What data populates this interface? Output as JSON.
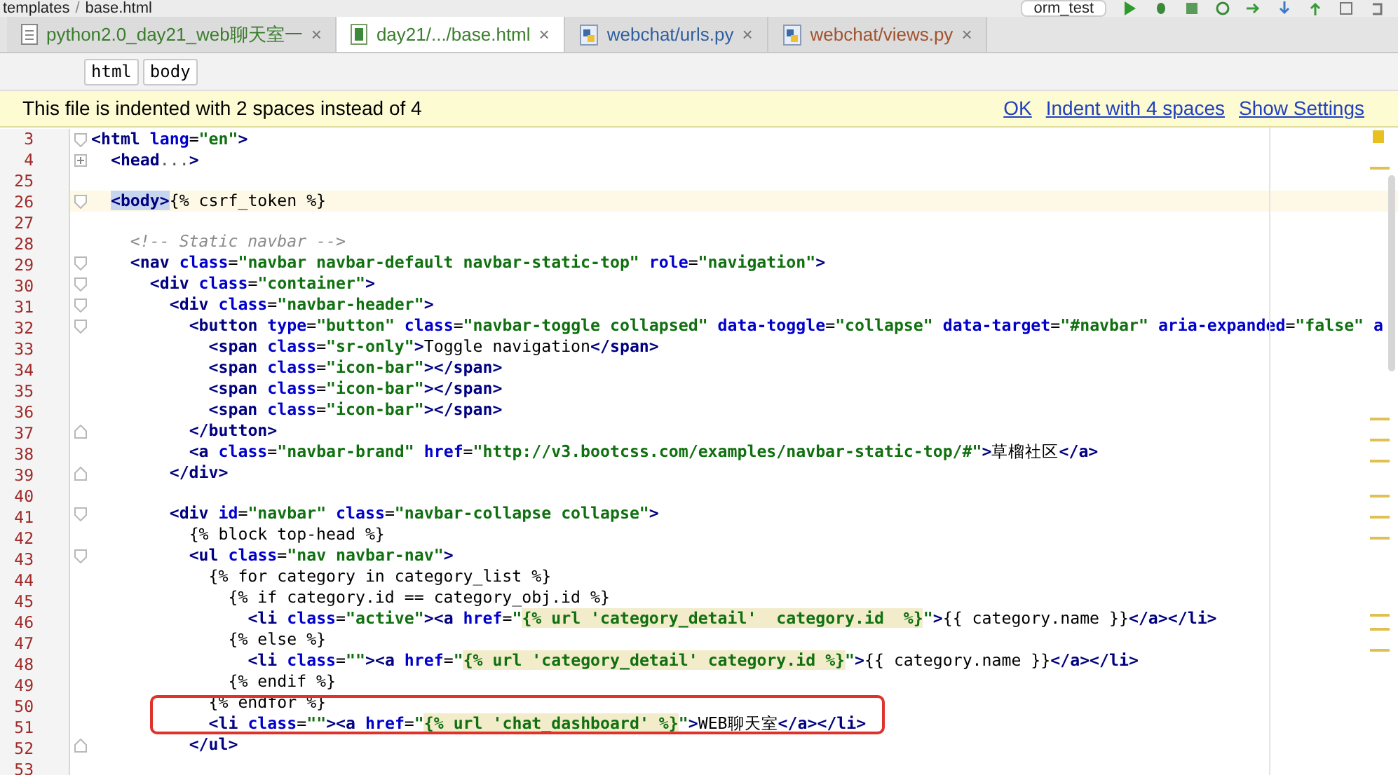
{
  "path_bar": {
    "items": [
      "templates",
      "base.html"
    ],
    "separator": "/",
    "run_config": "orm_test"
  },
  "tabs": [
    {
      "label": "python2.0_day21_web聊天室一",
      "close": "×",
      "selected": false,
      "kind": "text",
      "color": "#3a7d2c"
    },
    {
      "label": "day21/.../base.html",
      "close": "×",
      "selected": true,
      "kind": "html",
      "color": "#3a7d2c"
    },
    {
      "label": "webchat/urls.py",
      "close": "×",
      "selected": false,
      "kind": "python",
      "color": "#2f5fa0"
    },
    {
      "label": "webchat/views.py",
      "close": "×",
      "selected": false,
      "kind": "python",
      "color": "#a0522d"
    }
  ],
  "breadcrumbs": [
    "html",
    "body"
  ],
  "notice": {
    "text": "This file is indented with 2 spaces instead of 4",
    "actions": [
      "OK",
      "Indent with 4 spaces",
      "Show Settings"
    ]
  },
  "lines": [
    {
      "no": "3",
      "current": false,
      "fold": {
        "kind": "start"
      },
      "tokens": [
        {
          "kind": "tag",
          "text": "<html"
        },
        {
          "kind": "attr",
          "text": " lang"
        },
        {
          "kind": "plain",
          "text": "="
        },
        {
          "kind": "str",
          "text": "\"en\""
        },
        {
          "kind": "tag",
          "text": ">"
        }
      ]
    },
    {
      "no": "4",
      "current": false,
      "fold": {
        "kind": "collapsed"
      },
      "tokens": [
        {
          "kind": "tag",
          "text": "  <head"
        },
        {
          "kind": "dim",
          "text": "..."
        },
        {
          "kind": "tag",
          "text": ">"
        }
      ]
    },
    {
      "no": "25",
      "current": false
    },
    {
      "no": "26",
      "current": true,
      "fold": {
        "kind": "start"
      },
      "tokens": [
        {
          "kind": "tagsel",
          "text": "  <body>"
        },
        {
          "kind": "plain",
          "text": "{% csrf_token %}"
        }
      ]
    },
    {
      "no": "27",
      "current": false
    },
    {
      "no": "28",
      "current": false,
      "tokens": [
        {
          "kind": "comment",
          "text": "    <!-- Static navbar -->"
        }
      ]
    },
    {
      "no": "29",
      "current": false,
      "fold": {
        "kind": "start"
      },
      "tokens": [
        {
          "kind": "tag",
          "text": "    <nav"
        },
        {
          "kind": "attr",
          "text": " class"
        },
        {
          "kind": "plain",
          "text": "="
        },
        {
          "kind": "str",
          "text": "\"navbar navbar-default navbar-static-top\""
        },
        {
          "kind": "attr",
          "text": " role"
        },
        {
          "kind": "plain",
          "text": "="
        },
        {
          "kind": "str",
          "text": "\"navigation\""
        },
        {
          "kind": "tag",
          "text": ">"
        }
      ]
    },
    {
      "no": "30",
      "current": false,
      "fold": {
        "kind": "start"
      },
      "tokens": [
        {
          "kind": "tag",
          "text": "      <div"
        },
        {
          "kind": "attr",
          "text": " class"
        },
        {
          "kind": "plain",
          "text": "="
        },
        {
          "kind": "str",
          "text": "\"container\""
        },
        {
          "kind": "tag",
          "text": ">"
        }
      ]
    },
    {
      "no": "31",
      "current": false,
      "fold": {
        "kind": "start"
      },
      "tokens": [
        {
          "kind": "tag",
          "text": "        <div"
        },
        {
          "kind": "attr",
          "text": " class"
        },
        {
          "kind": "plain",
          "text": "="
        },
        {
          "kind": "str",
          "text": "\"navbar-header\""
        },
        {
          "kind": "tag",
          "text": ">"
        }
      ]
    },
    {
      "no": "32",
      "current": false,
      "fold": {
        "kind": "start"
      },
      "tokens": [
        {
          "kind": "tag",
          "text": "          <button"
        },
        {
          "kind": "attr",
          "text": " type"
        },
        {
          "kind": "plain",
          "text": "="
        },
        {
          "kind": "str",
          "text": "\"button\""
        },
        {
          "kind": "attr",
          "text": " class"
        },
        {
          "kind": "plain",
          "text": "="
        },
        {
          "kind": "str",
          "text": "\"navbar-toggle collapsed\""
        },
        {
          "kind": "attr",
          "text": " data-toggle"
        },
        {
          "kind": "plain",
          "text": "="
        },
        {
          "kind": "str",
          "text": "\"collapse\""
        },
        {
          "kind": "attr",
          "text": " data-target"
        },
        {
          "kind": "plain",
          "text": "="
        },
        {
          "kind": "str",
          "text": "\"#navbar\""
        },
        {
          "kind": "attr",
          "text": " aria-expanded"
        },
        {
          "kind": "plain",
          "text": "="
        },
        {
          "kind": "str",
          "text": "\"false\""
        },
        {
          "kind": "attr",
          "text": " a"
        }
      ]
    },
    {
      "no": "33",
      "current": false,
      "tokens": [
        {
          "kind": "tag",
          "text": "            <span"
        },
        {
          "kind": "attr",
          "text": " class"
        },
        {
          "kind": "plain",
          "text": "="
        },
        {
          "kind": "str",
          "text": "\"sr-only\""
        },
        {
          "kind": "tag",
          "text": ">"
        },
        {
          "kind": "plain",
          "text": "Toggle navigation"
        },
        {
          "kind": "tag",
          "text": "</span>"
        }
      ]
    },
    {
      "no": "34",
      "current": false,
      "tokens": [
        {
          "kind": "tag",
          "text": "            <span"
        },
        {
          "kind": "attr",
          "text": " class"
        },
        {
          "kind": "plain",
          "text": "="
        },
        {
          "kind": "str",
          "text": "\"icon-bar\""
        },
        {
          "kind": "tag",
          "text": "></span>"
        }
      ]
    },
    {
      "no": "35",
      "current": false,
      "tokens": [
        {
          "kind": "tag",
          "text": "            <span"
        },
        {
          "kind": "attr",
          "text": " class"
        },
        {
          "kind": "plain",
          "text": "="
        },
        {
          "kind": "str",
          "text": "\"icon-bar\""
        },
        {
          "kind": "tag",
          "text": "></span>"
        }
      ]
    },
    {
      "no": "36",
      "current": false,
      "tokens": [
        {
          "kind": "tag",
          "text": "            <span"
        },
        {
          "kind": "attr",
          "text": " class"
        },
        {
          "kind": "plain",
          "text": "="
        },
        {
          "kind": "str",
          "text": "\"icon-bar\""
        },
        {
          "kind": "tag",
          "text": "></span>"
        }
      ]
    },
    {
      "no": "37",
      "current": false,
      "fold": {
        "kind": "end"
      },
      "tokens": [
        {
          "kind": "tag",
          "text": "          </button>"
        }
      ]
    },
    {
      "no": "38",
      "current": false,
      "tokens": [
        {
          "kind": "tag",
          "text": "          <a"
        },
        {
          "kind": "attr",
          "text": " class"
        },
        {
          "kind": "plain",
          "text": "="
        },
        {
          "kind": "str",
          "text": "\"navbar-brand\""
        },
        {
          "kind": "attr",
          "text": " href"
        },
        {
          "kind": "plain",
          "text": "="
        },
        {
          "kind": "str",
          "text": "\"http://v3.bootcss.com/examples/navbar-static-top/#\""
        },
        {
          "kind": "tag",
          "text": ">"
        },
        {
          "kind": "plain",
          "text": "草榴社区"
        },
        {
          "kind": "tag",
          "text": "</a>"
        }
      ]
    },
    {
      "no": "39",
      "current": false,
      "fold": {
        "kind": "end"
      },
      "tokens": [
        {
          "kind": "tag",
          "text": "        </div>"
        }
      ]
    },
    {
      "no": "40",
      "current": false
    },
    {
      "no": "41",
      "current": false,
      "fold": {
        "kind": "start"
      },
      "tokens": [
        {
          "kind": "tag",
          "text": "        <div"
        },
        {
          "kind": "attr",
          "text": " id"
        },
        {
          "kind": "plain",
          "text": "="
        },
        {
          "kind": "str",
          "text": "\"navbar\""
        },
        {
          "kind": "attr",
          "text": " class"
        },
        {
          "kind": "plain",
          "text": "="
        },
        {
          "kind": "str",
          "text": "\"navbar-collapse collapse\""
        },
        {
          "kind": "tag",
          "text": ">"
        }
      ]
    },
    {
      "no": "42",
      "current": false,
      "tokens": [
        {
          "kind": "plain",
          "text": "          {% block top-head %}"
        }
      ]
    },
    {
      "no": "43",
      "current": false,
      "fold": {
        "kind": "start"
      },
      "tokens": [
        {
          "kind": "tag",
          "text": "          <ul"
        },
        {
          "kind": "attr",
          "text": " class"
        },
        {
          "kind": "plain",
          "text": "="
        },
        {
          "kind": "str",
          "text": "\"nav navbar-nav\""
        },
        {
          "kind": "tag",
          "text": ">"
        }
      ]
    },
    {
      "no": "44",
      "current": false,
      "tokens": [
        {
          "kind": "plain",
          "text": "            {% for category in category_list %}"
        }
      ]
    },
    {
      "no": "45",
      "current": false,
      "tokens": [
        {
          "kind": "plain",
          "text": "              {% if category.id == category_obj.id %}"
        }
      ]
    },
    {
      "no": "46",
      "current": false,
      "tokens": [
        {
          "kind": "tag",
          "text": "                <li"
        },
        {
          "kind": "attr",
          "text": " class"
        },
        {
          "kind": "plain",
          "text": "="
        },
        {
          "kind": "str",
          "text": "\"active\""
        },
        {
          "kind": "tag",
          "text": "><a"
        },
        {
          "kind": "attr",
          "text": " href"
        },
        {
          "kind": "plain",
          "text": "="
        },
        {
          "kind": "str",
          "text": "\""
        },
        {
          "kind": "tpl",
          "text": "{% url 'category_detail'  category.id  %}"
        },
        {
          "kind": "str",
          "text": "\""
        },
        {
          "kind": "tag",
          "text": ">"
        },
        {
          "kind": "plain",
          "text": "{{ category.name }}"
        },
        {
          "kind": "tag",
          "text": "</a></li>"
        }
      ]
    },
    {
      "no": "47",
      "current": false,
      "tokens": [
        {
          "kind": "plain",
          "text": "              {% else %}"
        }
      ]
    },
    {
      "no": "48",
      "current": false,
      "tokens": [
        {
          "kind": "tag",
          "text": "                <li"
        },
        {
          "kind": "attr",
          "text": " class"
        },
        {
          "kind": "plain",
          "text": "="
        },
        {
          "kind": "str",
          "text": "\"\""
        },
        {
          "kind": "tag",
          "text": "><a"
        },
        {
          "kind": "attr",
          "text": " href"
        },
        {
          "kind": "plain",
          "text": "="
        },
        {
          "kind": "str",
          "text": "\""
        },
        {
          "kind": "tpl",
          "text": "{% url 'category_detail' category.id %}"
        },
        {
          "kind": "str",
          "text": "\""
        },
        {
          "kind": "tag",
          "text": ">"
        },
        {
          "kind": "plain",
          "text": "{{ category.name }}"
        },
        {
          "kind": "tag",
          "text": "</a></li>"
        }
      ]
    },
    {
      "no": "49",
      "current": false,
      "tokens": [
        {
          "kind": "plain",
          "text": "              {% endif %}"
        }
      ]
    },
    {
      "no": "50",
      "current": false,
      "tokens": [
        {
          "kind": "plain",
          "text": "            {% endfor %}"
        }
      ]
    },
    {
      "no": "51",
      "current": false,
      "tokens": [
        {
          "kind": "tag",
          "text": "            <li"
        },
        {
          "kind": "attr",
          "text": " class"
        },
        {
          "kind": "plain",
          "text": "="
        },
        {
          "kind": "str",
          "text": "\"\""
        },
        {
          "kind": "tag",
          "text": "><a"
        },
        {
          "kind": "attr",
          "text": " href"
        },
        {
          "kind": "plain",
          "text": "="
        },
        {
          "kind": "str",
          "text": "\""
        },
        {
          "kind": "tpl",
          "text": "{% url 'chat_dashboard' %}"
        },
        {
          "kind": "str",
          "text": "\""
        },
        {
          "kind": "tag",
          "text": ">"
        },
        {
          "kind": "plain",
          "text": "WEB聊天室"
        },
        {
          "kind": "tag",
          "text": "</a></li>"
        }
      ]
    },
    {
      "no": "52",
      "current": false,
      "fold": {
        "kind": "end"
      },
      "tokens": [
        {
          "kind": "tag",
          "text": "          </ul>"
        }
      ]
    },
    {
      "no": "53",
      "current": false
    }
  ]
}
